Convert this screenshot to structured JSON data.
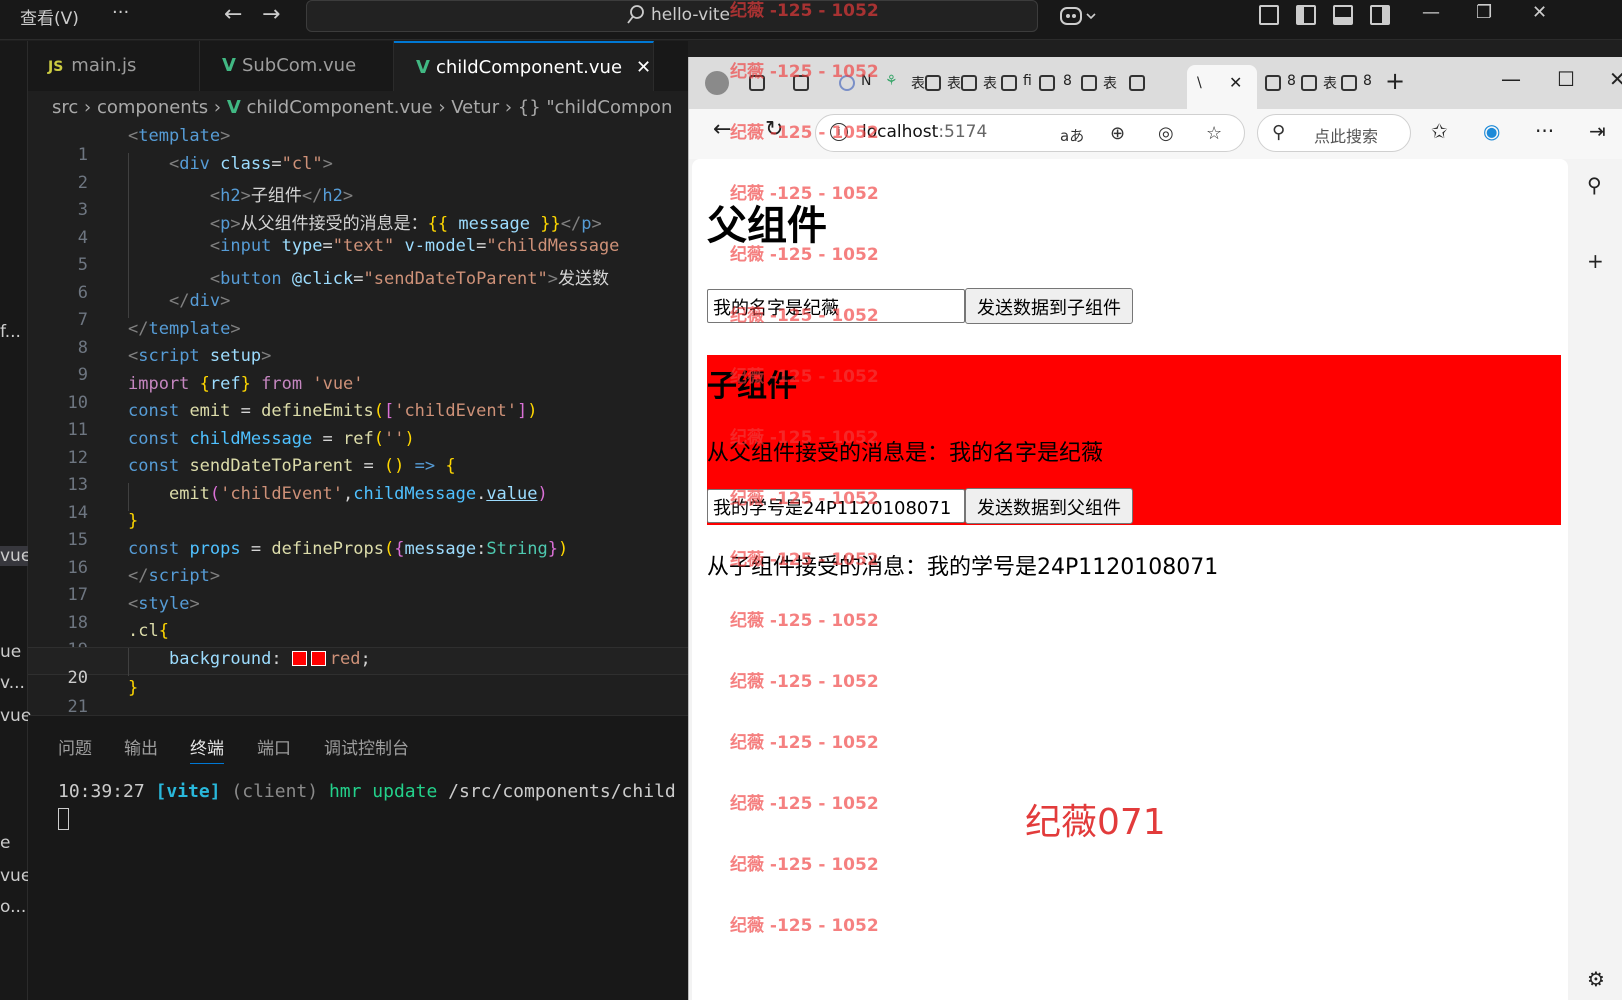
{
  "titlebar": {
    "menu_view": "查看(V)",
    "more": "···",
    "search_text": "hello-vite"
  },
  "sidebar_fragments": [
    "f...",
    "vue",
    "ue",
    "v...",
    "vue",
    "e",
    "vue",
    "o..."
  ],
  "editor_tabs": [
    {
      "icon": "JS",
      "label": "main.js"
    },
    {
      "icon": "V",
      "label": "SubCom.vue"
    },
    {
      "icon": "V",
      "label": "childComponent.vue",
      "close": "✕"
    }
  ],
  "breadcrumb": {
    "p1": "src",
    "p2": "components",
    "p3": "childComponent.vue",
    "p4": "Vetur",
    "p5": "{} \"childCompon"
  },
  "line_numbers": [
    "1",
    "2",
    "3",
    "4",
    "5",
    "6",
    "7",
    "8",
    "9",
    "10",
    "11",
    "12",
    "13",
    "14",
    "15",
    "16",
    "17",
    "18",
    "19",
    "20",
    "21"
  ],
  "code": {
    "l1": {
      "open": "<",
      "tag": "template",
      "close": ">"
    },
    "l2": {
      "tag": "div",
      "attr": "class",
      "val": "\"cl\""
    },
    "l3": {
      "tag": "h2",
      "text": "子组件"
    },
    "l4": {
      "tag": "p",
      "text": "从父组件接受的消息是：",
      "mustache_open": "{{",
      "expr": " message ",
      "mustache_close": "}}"
    },
    "l5": {
      "tag": "input",
      "a1": "type",
      "v1": "\"text\"",
      "a2": "v-model",
      "v2": "\"childMessage"
    },
    "l6": {
      "tag": "button",
      "a1": "@click",
      "v1": "\"sendDateToParent\"",
      "text": "发送数"
    },
    "l7": {
      "tag": "div"
    },
    "l8": {
      "tag": "template"
    },
    "l9": {
      "tag": "script",
      "attr": "setup"
    },
    "l10": {
      "kw": "import",
      "lb": "{",
      "name": "ref",
      "rb": "}",
      "from": "from",
      "str": "'vue'"
    },
    "l11": {
      "kw": "const",
      "name": "emit",
      "eq": " = ",
      "fn": "defineEmits",
      "p1": "(",
      "b1": "[",
      "str": "'childEvent'",
      "b2": "]",
      "p2": ")"
    },
    "l12": {
      "kw": "const",
      "name": "childMessage",
      "eq": " = ",
      "fn": "ref",
      "p1": "(",
      "str": "''",
      "p2": ")"
    },
    "l13": {
      "kw": "const",
      "name": "sendDateToParent",
      "eq": " = ",
      "args": "()",
      "arrow": " => ",
      "brace": "{"
    },
    "l14": {
      "fn": "emit",
      "p1": "(",
      "str": "'childEvent'",
      "comma": ",",
      "obj": "childMessage",
      "dot": ".",
      "prop": "value",
      "p2": ")"
    },
    "l15": {
      "brace": "}"
    },
    "l16": {
      "kw": "const",
      "name": "props",
      "eq": " = ",
      "fn": "defineProps",
      "p1": "(",
      "b1": "{",
      "key": "message",
      "colon": ":",
      "type": "String",
      "b2": "}",
      "p2": ")"
    },
    "l17": {
      "tag": "script"
    },
    "l18": {
      "tag": "style"
    },
    "l19": {
      "sel": ".cl",
      "brace": "{"
    },
    "l20": {
      "prop": "background",
      "colon": ": ",
      "val": "red",
      "semi": ";"
    },
    "l21": {
      "brace": "}"
    }
  },
  "panel": {
    "tabs": [
      "问题",
      "输出",
      "终端",
      "端口",
      "调试控制台"
    ],
    "active_tab": "终端",
    "term_time": "10:39:27 ",
    "term_vite": "[vite]",
    "term_client": " (client) ",
    "term_hmr": "hmr update",
    "term_path": " /src/components/child"
  },
  "browser": {
    "tab_labels": [
      "N",
      "表",
      "表",
      "表",
      "fi",
      "8",
      "表",
      "\\",
      "8",
      "表",
      "8"
    ],
    "active_tab_label": "\\",
    "active_tab_close": "✕",
    "new_tab": "+",
    "url_host": "localhost",
    "url_port": ":5174",
    "read_aloud": "aあ",
    "search_placeholder": "点此搜索"
  },
  "page": {
    "parent_title": "父组件",
    "parent_input_value": "我的名字是纪薇",
    "parent_button": "发送数据到子组件",
    "child_title": "子组件",
    "child_message": "从父组件接受的消息是：我的名字是纪薇",
    "child_input_value": "我的学号是24P1120108071",
    "child_button": "发送数据到父组件",
    "parent_message": "从子组件接受的消息：我的学号是24P1120108071",
    "big_watermark": "纪薇071"
  },
  "watermark": {
    "text": "纪薇 -125 - 1052",
    "count": 16
  },
  "colors": {
    "child_bg": "#ff0000",
    "vscode_bg": "#1f1f1f",
    "accent": "#0078d4"
  }
}
